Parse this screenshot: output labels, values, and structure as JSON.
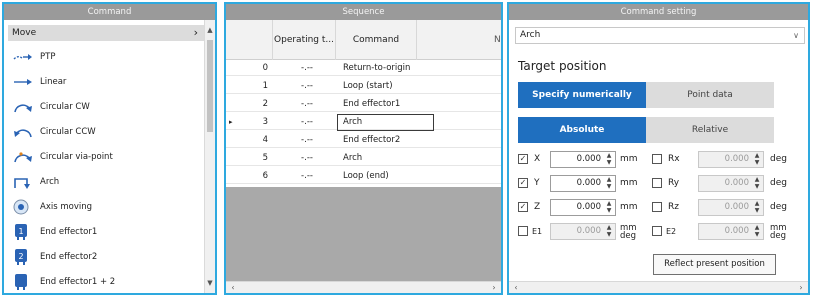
{
  "command_pane": {
    "title": "Command",
    "category": "Move",
    "items": [
      {
        "label": "PTP",
        "icon": "ptp-icon"
      },
      {
        "label": "Linear",
        "icon": "linear-arrow-icon"
      },
      {
        "label": "Circular CW",
        "icon": "circular-cw-icon"
      },
      {
        "label": "Circular CCW",
        "icon": "circular-ccw-icon"
      },
      {
        "label": "Circular via-point",
        "icon": "circular-via-point-icon"
      },
      {
        "label": "Arch",
        "icon": "arch-icon"
      },
      {
        "label": "Axis moving",
        "icon": "axis-moving-icon"
      },
      {
        "label": "End effector1",
        "icon": "end-effector1-icon"
      },
      {
        "label": "End effector2",
        "icon": "end-effector2-icon"
      },
      {
        "label": "End effector1 + 2",
        "icon": "end-effector1-2-icon"
      }
    ]
  },
  "sequence_pane": {
    "title": "Sequence",
    "columns": [
      "Operating t...",
      "Command",
      "N"
    ],
    "rows": [
      {
        "index": "0",
        "op_time": "-.--",
        "command": "Return-to-origin",
        "current": false
      },
      {
        "index": "1",
        "op_time": "-.--",
        "command": "Loop (start)",
        "current": false
      },
      {
        "index": "2",
        "op_time": "-.--",
        "command": "End effector1",
        "current": false
      },
      {
        "index": "3",
        "op_time": "-.--",
        "command": "Arch",
        "current": true
      },
      {
        "index": "4",
        "op_time": "-.--",
        "command": "End effector2",
        "current": false
      },
      {
        "index": "5",
        "op_time": "-.--",
        "command": "Arch",
        "current": false
      },
      {
        "index": "6",
        "op_time": "-.--",
        "command": "Loop (end)",
        "current": false
      }
    ],
    "current_marker": "▸"
  },
  "setting_pane": {
    "title": "Command setting",
    "selected_command": "Arch",
    "section_title": "Target position",
    "mode_tabs": {
      "active": "Specify numerically",
      "inactive": "Point data"
    },
    "coord_tabs": {
      "active": "Absolute",
      "inactive": "Relative"
    },
    "axes_left": [
      {
        "name": "X",
        "checked": true,
        "value": "0.000",
        "unit": "mm",
        "enabled": true
      },
      {
        "name": "Y",
        "checked": true,
        "value": "0.000",
        "unit": "mm",
        "enabled": true
      },
      {
        "name": "Z",
        "checked": true,
        "value": "0.000",
        "unit": "mm",
        "enabled": true
      },
      {
        "name": "E1",
        "checked": false,
        "value": "0.000",
        "unit": "mm deg",
        "unit_top": "mm",
        "unit_bottom": "deg",
        "enabled": false
      }
    ],
    "axes_right": [
      {
        "name": "Rx",
        "checked": false,
        "value": "0.000",
        "unit": "deg",
        "enabled": false
      },
      {
        "name": "Ry",
        "checked": false,
        "value": "0.000",
        "unit": "deg",
        "enabled": false
      },
      {
        "name": "Rz",
        "checked": false,
        "value": "0.000",
        "unit": "deg",
        "enabled": false
      },
      {
        "name": "E2",
        "checked": false,
        "value": "0.000",
        "unit": "mm deg",
        "unit_top": "mm",
        "unit_bottom": "deg",
        "enabled": false
      }
    ],
    "reflect_button": "Reflect present position"
  },
  "colors": {
    "pane_border": "#2ea9df",
    "title_bar": "#9a9a9a",
    "accent": "#1f6fbf",
    "icon_blue": "#2a63b4"
  }
}
